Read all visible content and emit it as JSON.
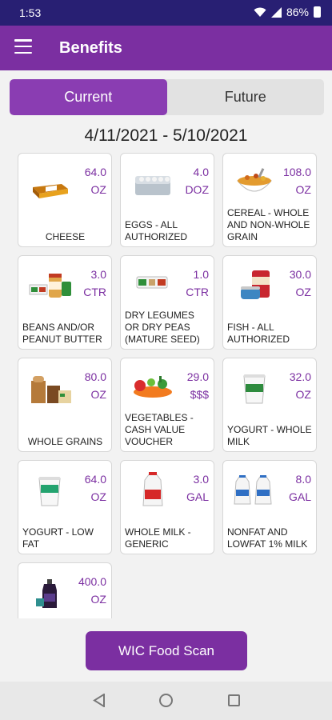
{
  "status": {
    "time": "1:53",
    "battery": "86%"
  },
  "appbar": {
    "title": "Benefits"
  },
  "tabs": [
    {
      "label": "Current"
    },
    {
      "label": "Future"
    }
  ],
  "date_range": "4/11/2021 - 5/10/2021",
  "benefits": [
    {
      "amount": "64.0",
      "unit": "OZ",
      "label": "CHEESE",
      "icon": "cheese-icon"
    },
    {
      "amount": "4.0",
      "unit": "DOZ",
      "label": "EGGS - ALL AUTHORIZED",
      "icon": "eggs-icon"
    },
    {
      "amount": "108.0",
      "unit": "OZ",
      "label": "CEREAL - WHOLE AND NON-WHOLE GRAIN",
      "icon": "cereal-icon"
    },
    {
      "amount": "3.0",
      "unit": "CTR",
      "label": "BEANS AND/OR PEANUT BUTTER",
      "icon": "beans-peanut-butter-icon"
    },
    {
      "amount": "1.0",
      "unit": "CTR",
      "label": "DRY LEGUMES OR DRY PEAS (MATURE SEED)",
      "icon": "dry-legumes-icon"
    },
    {
      "amount": "30.0",
      "unit": "OZ",
      "label": "FISH - ALL AUTHORIZED",
      "icon": "fish-can-icon"
    },
    {
      "amount": "80.0",
      "unit": "OZ",
      "label": "WHOLE GRAINS",
      "icon": "whole-grains-icon"
    },
    {
      "amount": "29.0",
      "unit": "$$$",
      "label": "VEGETABLES - CASH VALUE VOUCHER",
      "icon": "vegetables-icon"
    },
    {
      "amount": "32.0",
      "unit": "OZ",
      "label": "YOGURT - WHOLE MILK",
      "icon": "yogurt-icon"
    },
    {
      "amount": "64.0",
      "unit": "OZ",
      "label": "YOGURT - LOW FAT",
      "icon": "yogurt-low-fat-icon"
    },
    {
      "amount": "3.0",
      "unit": "GAL",
      "label": "WHOLE MILK - GENERIC",
      "icon": "milk-gallon-icon"
    },
    {
      "amount": "8.0",
      "unit": "GAL",
      "label": "NONFAT AND LOWFAT 1% MILK",
      "icon": "milk-jugs-icon"
    },
    {
      "amount": "400.0",
      "unit": "OZ",
      "label": "",
      "icon": "juice-bottle-icon"
    }
  ],
  "scan_button": {
    "label": "WIC Food Scan"
  },
  "colors": {
    "primary": "#7b2fa1",
    "status_bar": "#281f73",
    "tab_active": "#8a3db2"
  }
}
